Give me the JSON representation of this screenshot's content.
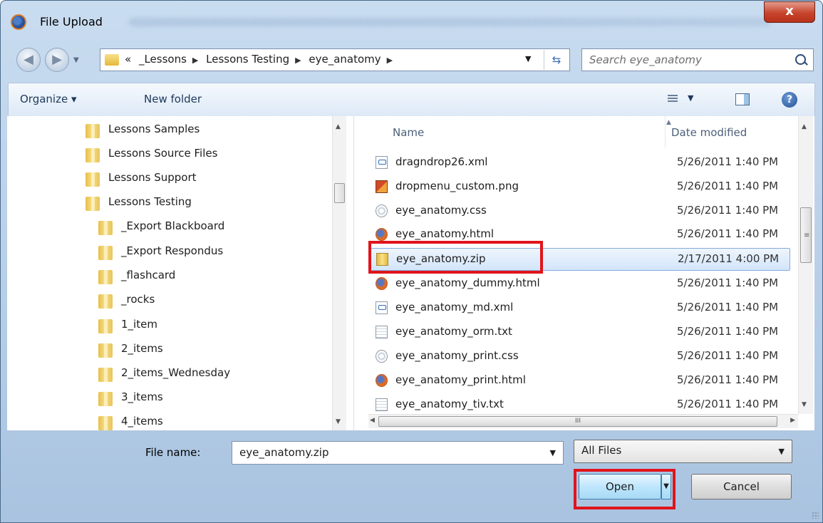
{
  "window": {
    "title": "File Upload",
    "close_glyph": "x"
  },
  "address_bar": {
    "overflow": "«",
    "path": [
      "_Lessons",
      "Lessons Testing",
      "eye_anatomy"
    ]
  },
  "search": {
    "placeholder": "Search eye_anatomy"
  },
  "toolbar": {
    "organize_label": "Organize ▾",
    "new_folder_label": "New folder"
  },
  "folder_tree": [
    "Lessons Samples",
    "Lessons Source Files",
    "Lessons Support",
    "Lessons Testing",
    "_Export Blackboard",
    "_Export Respondus",
    "_flashcard",
    "_rocks",
    "1_item",
    "2_items",
    "2_items_Wednesday",
    "3_items",
    "4_items"
  ],
  "file_list": {
    "columns": {
      "name": "Name",
      "date": "Date modified"
    },
    "rows": [
      {
        "name": "dragndrop26.xml",
        "date": "5/26/2011 1:40 PM",
        "icon": "xml-file-icon"
      },
      {
        "name": "dropmenu_custom.png",
        "date": "5/26/2011 1:40 PM",
        "icon": "image-file-icon"
      },
      {
        "name": "eye_anatomy.css",
        "date": "5/26/2011 1:40 PM",
        "icon": "css-file-icon"
      },
      {
        "name": "eye_anatomy.html",
        "date": "5/26/2011 1:40 PM",
        "icon": "firefox-html-icon"
      },
      {
        "name": "eye_anatomy.zip",
        "date": "2/17/2011 4:00 PM",
        "icon": "zip-folder-icon",
        "selected": true
      },
      {
        "name": "eye_anatomy_dummy.html",
        "date": "5/26/2011 1:40 PM",
        "icon": "firefox-html-icon"
      },
      {
        "name": "eye_anatomy_md.xml",
        "date": "5/26/2011 1:40 PM",
        "icon": "xml-file-icon"
      },
      {
        "name": "eye_anatomy_orm.txt",
        "date": "5/26/2011 1:40 PM",
        "icon": "text-file-icon"
      },
      {
        "name": "eye_anatomy_print.css",
        "date": "5/26/2011 1:40 PM",
        "icon": "css-file-icon"
      },
      {
        "name": "eye_anatomy_print.html",
        "date": "5/26/2011 1:40 PM",
        "icon": "firefox-html-icon"
      },
      {
        "name": "eye_anatomy_tiv.txt",
        "date": "5/26/2011 1:40 PM",
        "icon": "text-file-icon"
      }
    ]
  },
  "file_name": {
    "label": "File name:",
    "value": "eye_anatomy.zip"
  },
  "file_type_filter": {
    "value": "All Files"
  },
  "buttons": {
    "open_label": "Open",
    "cancel_label": "Cancel"
  },
  "colors": {
    "highlight_red": "#e0141b",
    "selection_blue": "#d3e5fa"
  }
}
